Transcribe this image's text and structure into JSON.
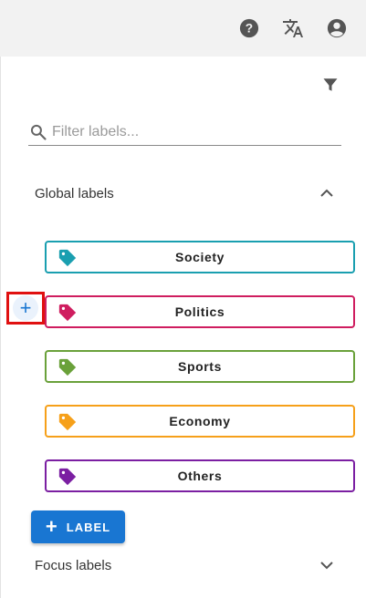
{
  "header": {
    "icons": [
      "help-icon",
      "translate-icon",
      "account-icon"
    ]
  },
  "filter": {
    "icon": "filter-icon",
    "search_placeholder": "Filter labels..."
  },
  "global_labels": {
    "title": "Global labels",
    "expanded": true,
    "items": [
      {
        "label": "Society",
        "color": "#1a9fb0"
      },
      {
        "label": "Politics",
        "color": "#cf1d5f"
      },
      {
        "label": "Sports",
        "color": "#6aa13a"
      },
      {
        "label": "Economy",
        "color": "#f6a01a"
      },
      {
        "label": "Others",
        "color": "#7b1fa2"
      }
    ]
  },
  "add_button": {
    "label": "LABEL",
    "color": "#1976d2"
  },
  "focus_labels": {
    "title": "Focus labels",
    "expanded": false
  },
  "highlight": {
    "color": "#e01010",
    "target": "add-label-to-politics"
  }
}
